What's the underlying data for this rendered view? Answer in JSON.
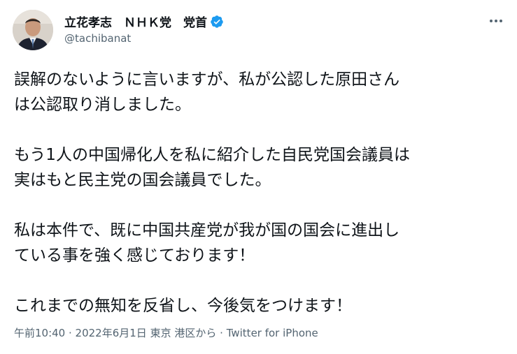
{
  "author": {
    "display_name": "立花孝志　ＮＨＫ党　党首",
    "handle": "@tachibanat",
    "verified": true
  },
  "tweet": {
    "paragraphs": [
      [
        "誤解のないように言いますが、私が公認した原田さん",
        "は公認取り消しました。"
      ],
      [
        "もう1人の中国帰化人を私に紹介した自民党国会議員は",
        "実はもと民主党の国会議員でした。"
      ],
      [
        "私は本件で、既に中国共産党が我が国の国会に進出し",
        "ている事を強く感じております！"
      ],
      [
        "これまでの無知を反省し、今後気をつけます！"
      ]
    ]
  },
  "meta": {
    "time": "午前10:40",
    "separator": " · ",
    "date": "2022年6月1日",
    "location": "東京 港区から",
    "source": "Twitter for iPhone"
  },
  "icons": {
    "verified": "verified-badge-icon",
    "more": "more-dots-icon"
  },
  "colors": {
    "verified": "#1d9bf0",
    "secondary_text": "#536471",
    "text": "#0f1419"
  }
}
